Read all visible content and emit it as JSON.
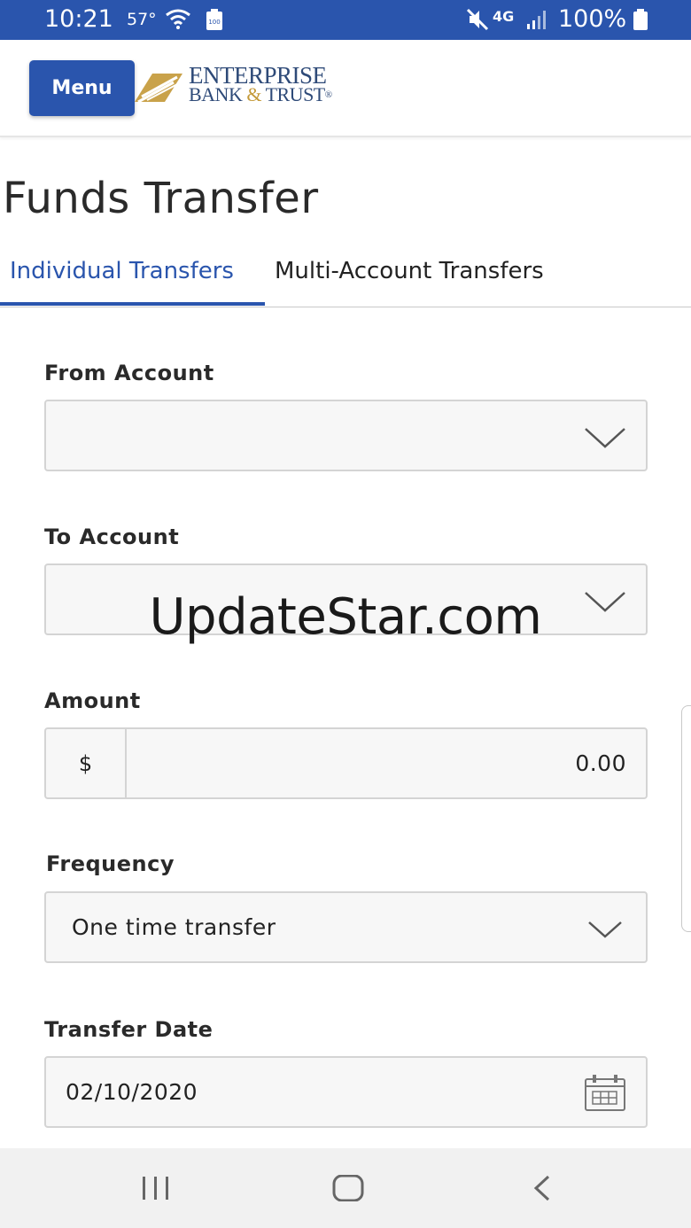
{
  "status_bar": {
    "time": "10:21",
    "temperature": "57°",
    "battery_small": "100",
    "network": "4G",
    "battery_percent": "100%"
  },
  "header": {
    "menu_label": "Menu",
    "logo_line1": "ENTERPRISE",
    "logo_line2_a": "BANK ",
    "logo_line2_amp": "&",
    "logo_line2_b": " TRUST",
    "logo_reg": "®"
  },
  "page": {
    "title": "Funds Transfer",
    "tabs": [
      {
        "label": "Individual Transfers",
        "active": true
      },
      {
        "label": "Multi-Account Transfers",
        "active": false
      }
    ]
  },
  "form": {
    "from_account": {
      "label": "From Account",
      "value": ""
    },
    "to_account": {
      "label": "To Account",
      "value": ""
    },
    "amount": {
      "label": "Amount",
      "currency": "$",
      "value": "0.00"
    },
    "frequency": {
      "label": "Frequency",
      "value": "One time transfer"
    },
    "transfer_date": {
      "label": "Transfer Date",
      "value": "02/10/2020"
    }
  },
  "watermark": "UpdateStar.com",
  "colors": {
    "brand_blue": "#2a55ad",
    "logo_gold": "#c49a3a",
    "logo_navy": "#2e4a78"
  },
  "icons": [
    "wifi-icon",
    "mute-icon",
    "signal-icon",
    "battery-icon",
    "chevron-down-icon",
    "calendar-icon",
    "recent-apps-icon",
    "home-icon",
    "back-icon"
  ]
}
